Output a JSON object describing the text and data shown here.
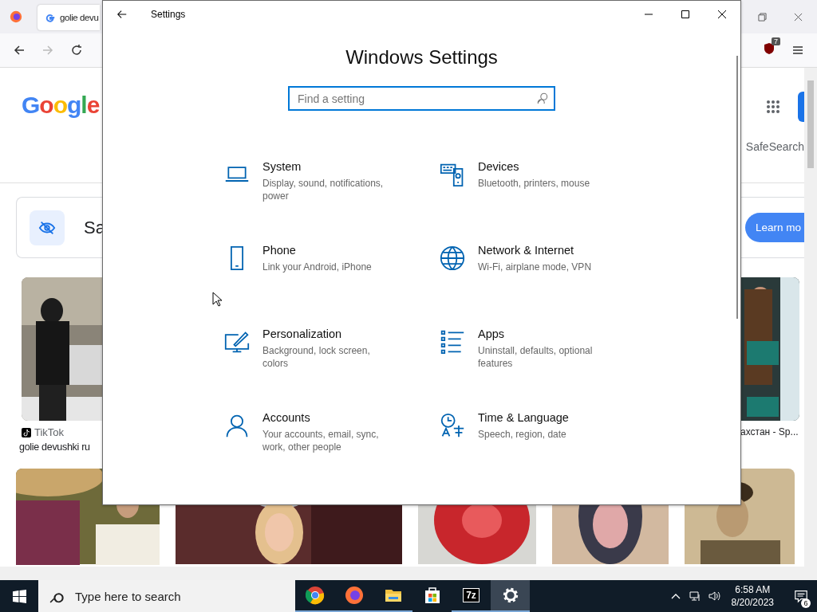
{
  "browser": {
    "tabs": [
      {
        "title": "golie devu",
        "selected": true
      }
    ],
    "extension_badge": "7",
    "logo": "Google",
    "safesearch_label": "SafeSearch",
    "safesearch_card": {
      "title": "Sa",
      "button": "Learn mo"
    },
    "results": [
      {
        "source": "TikTok",
        "title": "golie devushki ru"
      },
      {
        "title": "ахстан - Sp..."
      }
    ]
  },
  "settings": {
    "title": "Settings",
    "heading": "Windows Settings",
    "search": {
      "placeholder": "Find a setting"
    },
    "categories": [
      {
        "name": "System",
        "description": "Display, sound, notifications, power"
      },
      {
        "name": "Devices",
        "description": "Bluetooth, printers, mouse"
      },
      {
        "name": "Phone",
        "description": "Link your Android, iPhone"
      },
      {
        "name": "Network & Internet",
        "description": "Wi-Fi, airplane mode, VPN"
      },
      {
        "name": "Personalization",
        "description": "Background, lock screen, colors"
      },
      {
        "name": "Apps",
        "description": "Uninstall, defaults, optional features"
      },
      {
        "name": "Accounts",
        "description": "Your accounts, email, sync, work, other people"
      },
      {
        "name": "Time & Language",
        "description": "Speech, region, date"
      }
    ]
  },
  "taskbar": {
    "search": {
      "placeholder": "Type here to search"
    },
    "apps": [
      {
        "running": true,
        "selected": false
      },
      {
        "running": true,
        "selected": false
      },
      {
        "running": true,
        "selected": false
      },
      {
        "running": false,
        "selected": false
      },
      {
        "label": "7z",
        "running": true,
        "selected": false
      },
      {
        "running": true,
        "selected": true
      }
    ],
    "time": "6:58 AM",
    "date": "8/20/2023",
    "notifications": "6"
  }
}
